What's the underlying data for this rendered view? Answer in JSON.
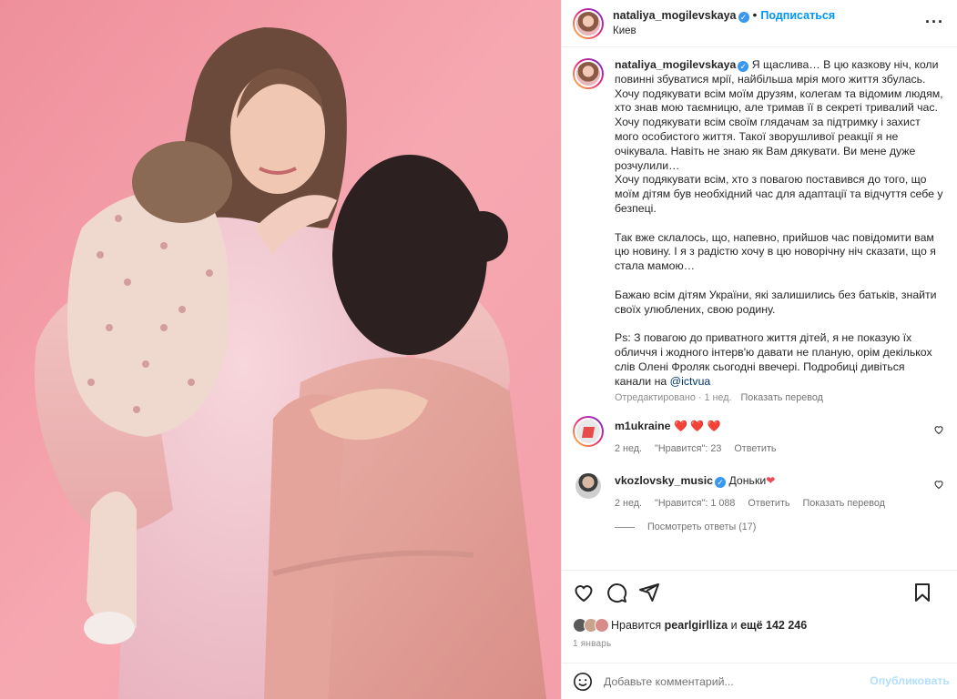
{
  "post": {
    "author": "nataliya_mogilevskaya",
    "follow_label": "Подписаться",
    "location": "Киев",
    "more_icon": "more-horizontal-icon"
  },
  "caption": {
    "author": "nataliya_mogilevskaya",
    "text": "Я щаслива… В цю казкову ніч, коли повинні збуватися мрії, найбільша мрія мого життя збулась.\nХочу подякувати всім моїм друзям, колегам та відомим людям, хто знав мою таємницю, але тримав її в секреті тривалий час.\nХочу подякувати всім своїм глядачам за підтримку і захист мого особистого життя. Такої зворушливої реакції я не очікувала. Навіть не знаю як Вам дякувати. Ви мене дуже розчулили…\nХочу подякувати всім, хто з повагою поставився до того, що моїм дітям був необхідний час для адаптації та відчуття себе у безпеці.\n\nТак вже склалось, що, напевно, прийшов час повідомити вам цю новину. І я з радістю хочу в цю новорічну ніч сказати, що я стала мамою…\n\nБажаю всім дітям України, які залишились без батьків, знайти своїх улюблених, свою родину.\n\nPs: З повагою до приватного життя дітей, я не показую їх обличчя і жодного інтерв'ю давати не планую, орім декількох слів Олені Фроляк сьогодні ввечері. Подробиці дивіться канали на ",
    "mention": "@ictvua",
    "edited": "Отредактировано",
    "time": "1 нед.",
    "translate": "Показать перевод"
  },
  "comments": [
    {
      "user": "m1ukraine",
      "text": "❤️ ❤️ ❤️",
      "time": "2 нед.",
      "likes": "\"Нравится\": 23",
      "reply": "Ответить"
    },
    {
      "user": "vkozlovsky_music",
      "text": "Доньки",
      "heart": "❤",
      "time": "2 нед.",
      "likes": "\"Нравится\": 1 088",
      "reply": "Ответить",
      "translate": "Показать перевод",
      "view_replies": "Посмотреть ответы (17)"
    }
  ],
  "likes": {
    "prefix": "Нравится",
    "user": "pearlgirlliza",
    "and": "и",
    "more": "ещё 142 246"
  },
  "date": "1 январь",
  "add_comment": {
    "placeholder": "Добавьте комментарий...",
    "publish": "Опубликовать"
  },
  "colors": {
    "accent": "#0095f6",
    "background_photo": "#f4a0ab",
    "verified": "#3897f0",
    "heart": "#ed4956"
  }
}
